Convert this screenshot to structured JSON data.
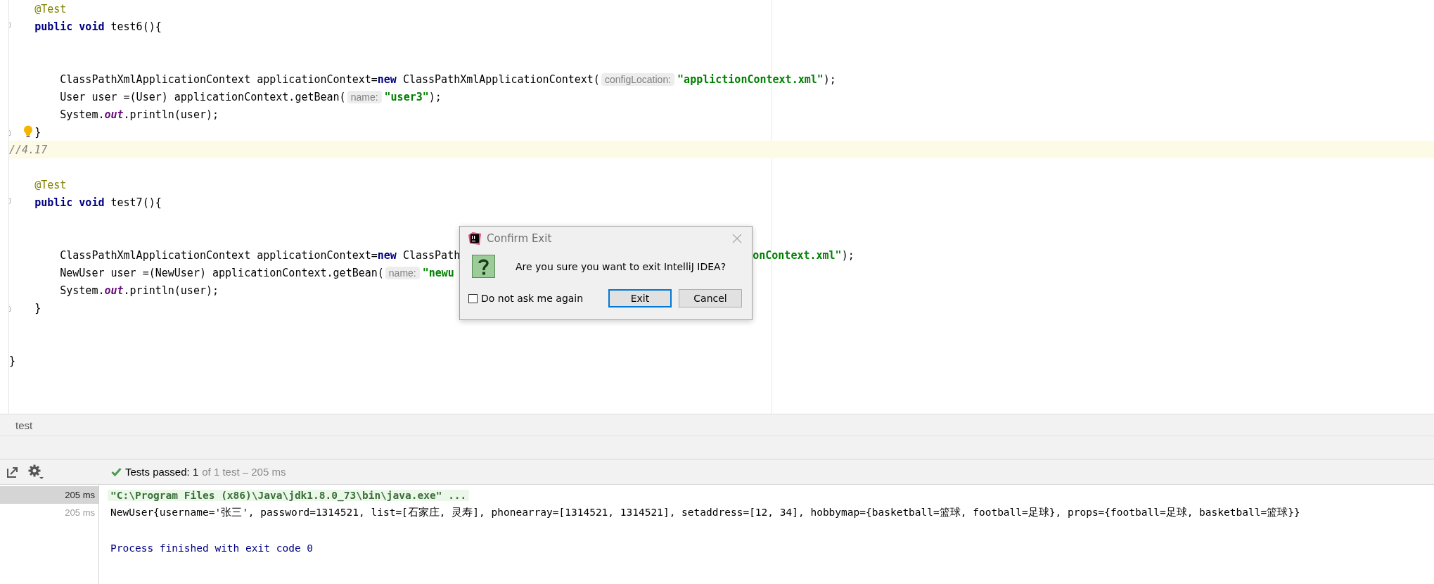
{
  "editor": {
    "lines": [
      {
        "kind": "code",
        "tokens": [
          {
            "kind": "annotation",
            "text": "    @Test"
          }
        ],
        "fold_start": false,
        "fold_end": false,
        "bulb": false,
        "highlighted": false
      },
      {
        "kind": "code",
        "tokens": [
          {
            "kind": "keyword",
            "text": "    public void "
          },
          {
            "kind": "plain",
            "text": "test6(){"
          }
        ],
        "fold_start": true,
        "fold_end": false,
        "bulb": false,
        "highlighted": false
      },
      {
        "kind": "blank"
      },
      {
        "kind": "blank"
      },
      {
        "kind": "code",
        "tokens": [
          {
            "kind": "plain",
            "text": "        ClassPathXmlApplicationContext applicationContext="
          },
          {
            "kind": "keyword",
            "text": "new"
          },
          {
            "kind": "plain",
            "text": " ClassPathXmlApplicationContext("
          },
          {
            "kind": "hint",
            "text": "configLocation:"
          },
          {
            "kind": "string",
            "text": "\"applictionContext.xml\""
          },
          {
            "kind": "plain",
            "text": ");"
          }
        ],
        "fold_start": false,
        "fold_end": false,
        "bulb": false,
        "highlighted": false
      },
      {
        "kind": "code",
        "tokens": [
          {
            "kind": "plain",
            "text": "        User user =(User) applicationContext.getBean("
          },
          {
            "kind": "hint",
            "text": "name:"
          },
          {
            "kind": "string",
            "text": "\"user3\""
          },
          {
            "kind": "plain",
            "text": ");"
          }
        ],
        "fold_start": false,
        "fold_end": false,
        "bulb": false,
        "highlighted": false
      },
      {
        "kind": "code",
        "tokens": [
          {
            "kind": "plain",
            "text": "        System."
          },
          {
            "kind": "field",
            "text": "out"
          },
          {
            "kind": "plain",
            "text": ".println(user);"
          }
        ],
        "fold_start": false,
        "fold_end": false,
        "bulb": false,
        "highlighted": false
      },
      {
        "kind": "code",
        "tokens": [
          {
            "kind": "plain",
            "text": "    }"
          }
        ],
        "fold_start": false,
        "fold_end": true,
        "bulb": true,
        "highlighted": false
      },
      {
        "kind": "code",
        "tokens": [
          {
            "kind": "comment",
            "text": "//4.17"
          }
        ],
        "fold_start": false,
        "fold_end": false,
        "bulb": false,
        "highlighted": true
      },
      {
        "kind": "blank"
      },
      {
        "kind": "code",
        "tokens": [
          {
            "kind": "annotation",
            "text": "    @Test"
          }
        ],
        "fold_start": false,
        "fold_end": false,
        "bulb": false,
        "highlighted": false
      },
      {
        "kind": "code",
        "tokens": [
          {
            "kind": "keyword",
            "text": "    public void "
          },
          {
            "kind": "plain",
            "text": "test7(){"
          }
        ],
        "fold_start": true,
        "fold_end": false,
        "bulb": false,
        "highlighted": false
      },
      {
        "kind": "blank"
      },
      {
        "kind": "blank"
      },
      {
        "kind": "code",
        "tokens": [
          {
            "kind": "plain",
            "text": "        ClassPathXmlApplicationContext applicationContext="
          },
          {
            "kind": "keyword",
            "text": "new"
          },
          {
            "kind": "plain",
            "text": " ClassPath"
          },
          {
            "kind": "covered"
          },
          {
            "kind": "string",
            "text": "onContext.xml\""
          },
          {
            "kind": "plain",
            "text": ");"
          }
        ],
        "fold_start": false,
        "fold_end": false,
        "bulb": false,
        "highlighted": false
      },
      {
        "kind": "code",
        "tokens": [
          {
            "kind": "plain",
            "text": "        NewUser user =(NewUser) applicationContext.getBean("
          },
          {
            "kind": "hint",
            "text": "name:"
          },
          {
            "kind": "string",
            "text": "\"newu"
          }
        ],
        "fold_start": false,
        "fold_end": false,
        "bulb": false,
        "highlighted": false
      },
      {
        "kind": "code",
        "tokens": [
          {
            "kind": "plain",
            "text": "        System."
          },
          {
            "kind": "field",
            "text": "out"
          },
          {
            "kind": "plain",
            "text": ".println(user);"
          }
        ],
        "fold_start": false,
        "fold_end": false,
        "bulb": false,
        "highlighted": false
      },
      {
        "kind": "code",
        "tokens": [
          {
            "kind": "plain",
            "text": "    }"
          }
        ],
        "fold_start": false,
        "fold_end": true,
        "bulb": false,
        "highlighted": false
      },
      {
        "kind": "blank"
      },
      {
        "kind": "blank"
      },
      {
        "kind": "code",
        "tokens": [
          {
            "kind": "plain",
            "text": "}"
          }
        ],
        "fold_start": false,
        "fold_end": false,
        "bulb": false,
        "highlighted": false
      }
    ]
  },
  "dialog": {
    "title": "Confirm Exit",
    "message": "Are you sure you want to exit IntelliJ IDEA?",
    "checkbox": {
      "label": "Do not ask me again",
      "checked": false
    },
    "buttons": [
      {
        "label": "Exit",
        "focused": true
      },
      {
        "label": "Cancel",
        "focused": false
      }
    ]
  },
  "breadcrumb": "test",
  "run_toolbar": {
    "status": "Tests passed: 1",
    "detail": "of 1 test – 205 ms"
  },
  "console": {
    "rows": [
      {
        "kind": "command",
        "time": "205 ms",
        "selected": true,
        "text": "\"C:\\Program Files (x86)\\Java\\jdk1.8.0_73\\bin\\java.exe\" ..."
      },
      {
        "kind": "output",
        "time": "205 ms",
        "selected": false,
        "text": "NewUser{username='张三', password=1314521, list=[石家庄, 灵寿], phonearray=[1314521, 1314521], setaddress=[12, 34], hobbymap={basketball=篮球, football=足球}, props={football=足球, basketball=篮球}}"
      },
      {
        "kind": "blank"
      },
      {
        "kind": "exit",
        "text": "Process finished with exit code 0"
      }
    ]
  }
}
